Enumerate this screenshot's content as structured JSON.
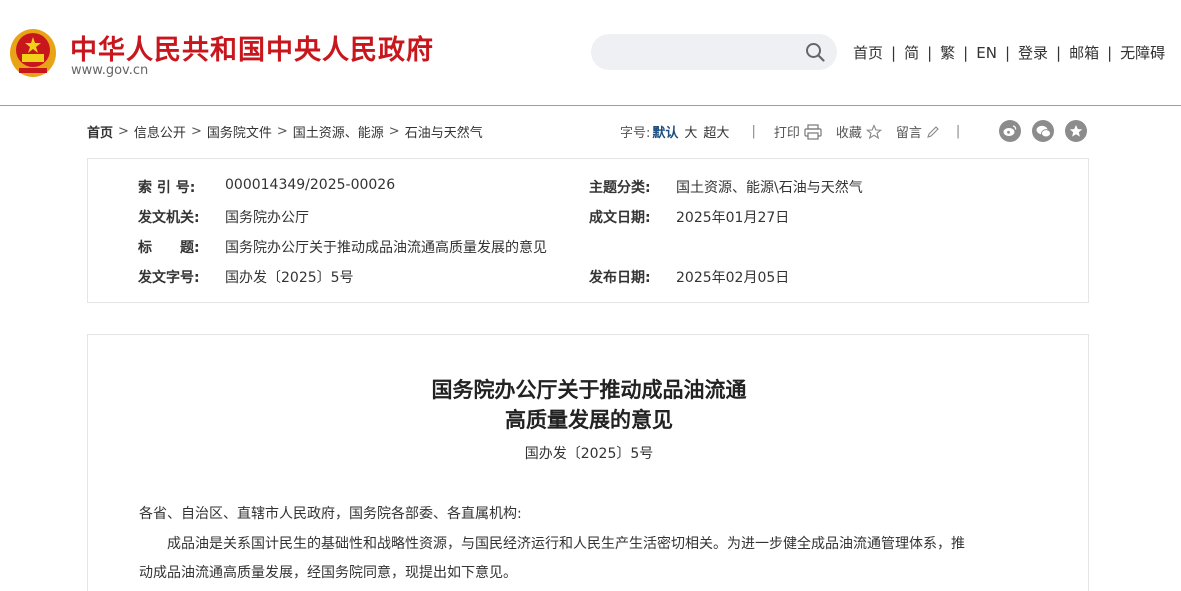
{
  "header": {
    "site_title": "中华人民共和国中央人民政府",
    "site_domain": "www.gov.cn",
    "search": {
      "placeholder": ""
    },
    "nav": [
      {
        "label": "首页"
      },
      {
        "label": "简"
      },
      {
        "label": "繁"
      },
      {
        "label": "EN"
      },
      {
        "label": "登录"
      },
      {
        "label": "邮箱"
      },
      {
        "label": "无障碍"
      }
    ],
    "nav_sep": "|"
  },
  "breadcrumb": {
    "items": [
      "首页",
      "信息公开",
      "国务院文件",
      "国土资源、能源",
      "石油与天然气"
    ],
    "sep": ">"
  },
  "tools": {
    "font_size_label": "字号:",
    "font_default": "默认",
    "font_large": "大",
    "font_xlarge": "超大",
    "sep": "|",
    "print": "打印",
    "favorite": "收藏",
    "comment": "留言"
  },
  "share": [
    "weibo-icon",
    "wechat-icon",
    "favorite-star-icon"
  ],
  "meta": {
    "index_no_key": "索 引 号:",
    "index_no_val": "000014349/2025-00026",
    "topic_key": "主题分类:",
    "topic_val": "国土资源、能源\\石油与天然气",
    "issuer_key": "发文机关:",
    "issuer_val": "国务院办公厅",
    "written_key": "成文日期:",
    "written_val": "2025年01月27日",
    "title_key": "标　　题:",
    "title_val": "国务院办公厅关于推动成品油流通高质量发展的意见",
    "docno_key": "发文字号:",
    "docno_val": "国办发〔2025〕5号",
    "published_key": "发布日期:",
    "published_val": "2025年02月05日"
  },
  "document": {
    "title_line1": "国务院办公厅关于推动成品油流通",
    "title_line2": "高质量发展的意见",
    "number": "国办发〔2025〕5号",
    "salutation": "各省、自治区、直辖市人民政府，国务院各部委、各直属机构:",
    "para1_line1": "　　成品油是关系国计民生的基础性和战略性资源，与国民经济运行和人民生产生活密切相关。为进一步健全成品油流通管理体系，推",
    "para1_line2": "动成品油流通高质量发展，经国务院同意，现提出如下意见。"
  },
  "colors": {
    "brand_red": "#c8161d",
    "emblem_gold": "#f2b705",
    "link_blue": "#1c4e80",
    "icon_gray": "#8c8c8c"
  }
}
